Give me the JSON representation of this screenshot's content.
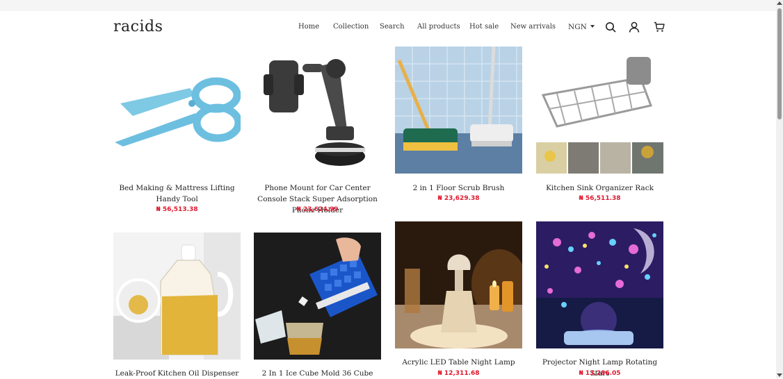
{
  "header": {
    "logo": "racids",
    "nav": [
      "Home",
      "Collection",
      "Search",
      "All products",
      "Hot sale",
      "New arrivals"
    ],
    "currency": "NGN",
    "icons": [
      "search-icon",
      "account-icon",
      "cart-icon"
    ]
  },
  "products": [
    {
      "title": "Bed Making & Mattress Lifting Handy Tool",
      "price": "₦ 56,513.38"
    },
    {
      "title": "Phone Mount for Car Center Console Stack Super Adsorption Phone Holder",
      "price": "₦ 23,624.99"
    },
    {
      "title": "2 in 1 Floor Scrub Brush",
      "price": "₦ 23,629.38"
    },
    {
      "title": "Kitchen Sink Organizer Rack",
      "price": "₦ 56,511.38"
    },
    {
      "title": "Leak-Proof Kitchen Oil Dispenser",
      "price": ""
    },
    {
      "title": "2 In 1 Ice Cube Mold 36 Cube",
      "price": ""
    },
    {
      "title": "Acrylic LED Table Night Lamp",
      "price": "₦ 12,311.68"
    },
    {
      "title": "Projector Night Lamp Rotating Stars",
      "price": "₦ 13,286.05"
    }
  ],
  "colors": {
    "price": "#e0182d",
    "text": "#222222"
  }
}
